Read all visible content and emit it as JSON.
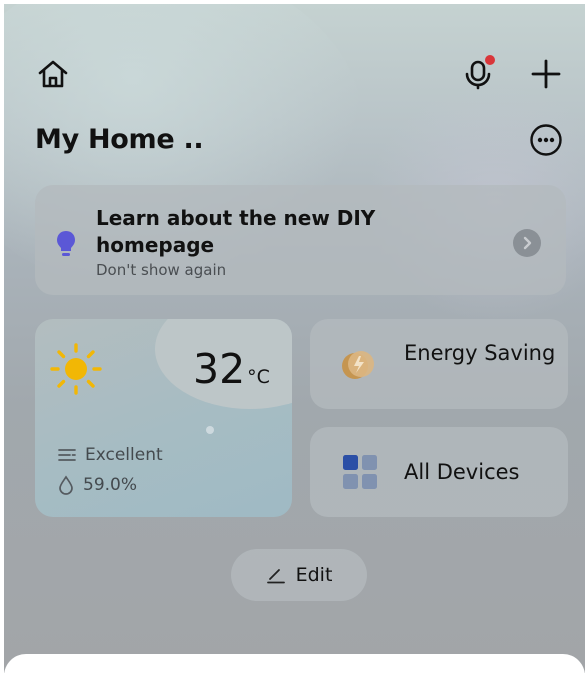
{
  "header": {
    "home_icon": "home-icon",
    "mic_icon": "microphone-icon",
    "mic_badge_color": "#d9363a",
    "add_icon": "plus-icon",
    "title": "My Home ..",
    "more_icon": "more-icon"
  },
  "notice": {
    "title": "Learn about the new DIY homepage",
    "dismiss": "Don't show again",
    "icon": "lightbulb-icon",
    "icon_color": "#5b58d6"
  },
  "weather": {
    "temperature": "32",
    "unit": "°C",
    "air_quality": "Excellent",
    "humidity": "59.0%",
    "icon": "sun-icon",
    "sun_color": "#f2b705"
  },
  "energy": {
    "label": "Energy Saving",
    "icon": "energy-icon"
  },
  "devices": {
    "label": "All Devices",
    "icon": "grid-icon",
    "accent": "#2b4fa6"
  },
  "edit": {
    "label": "Edit",
    "icon": "pencil-icon"
  }
}
